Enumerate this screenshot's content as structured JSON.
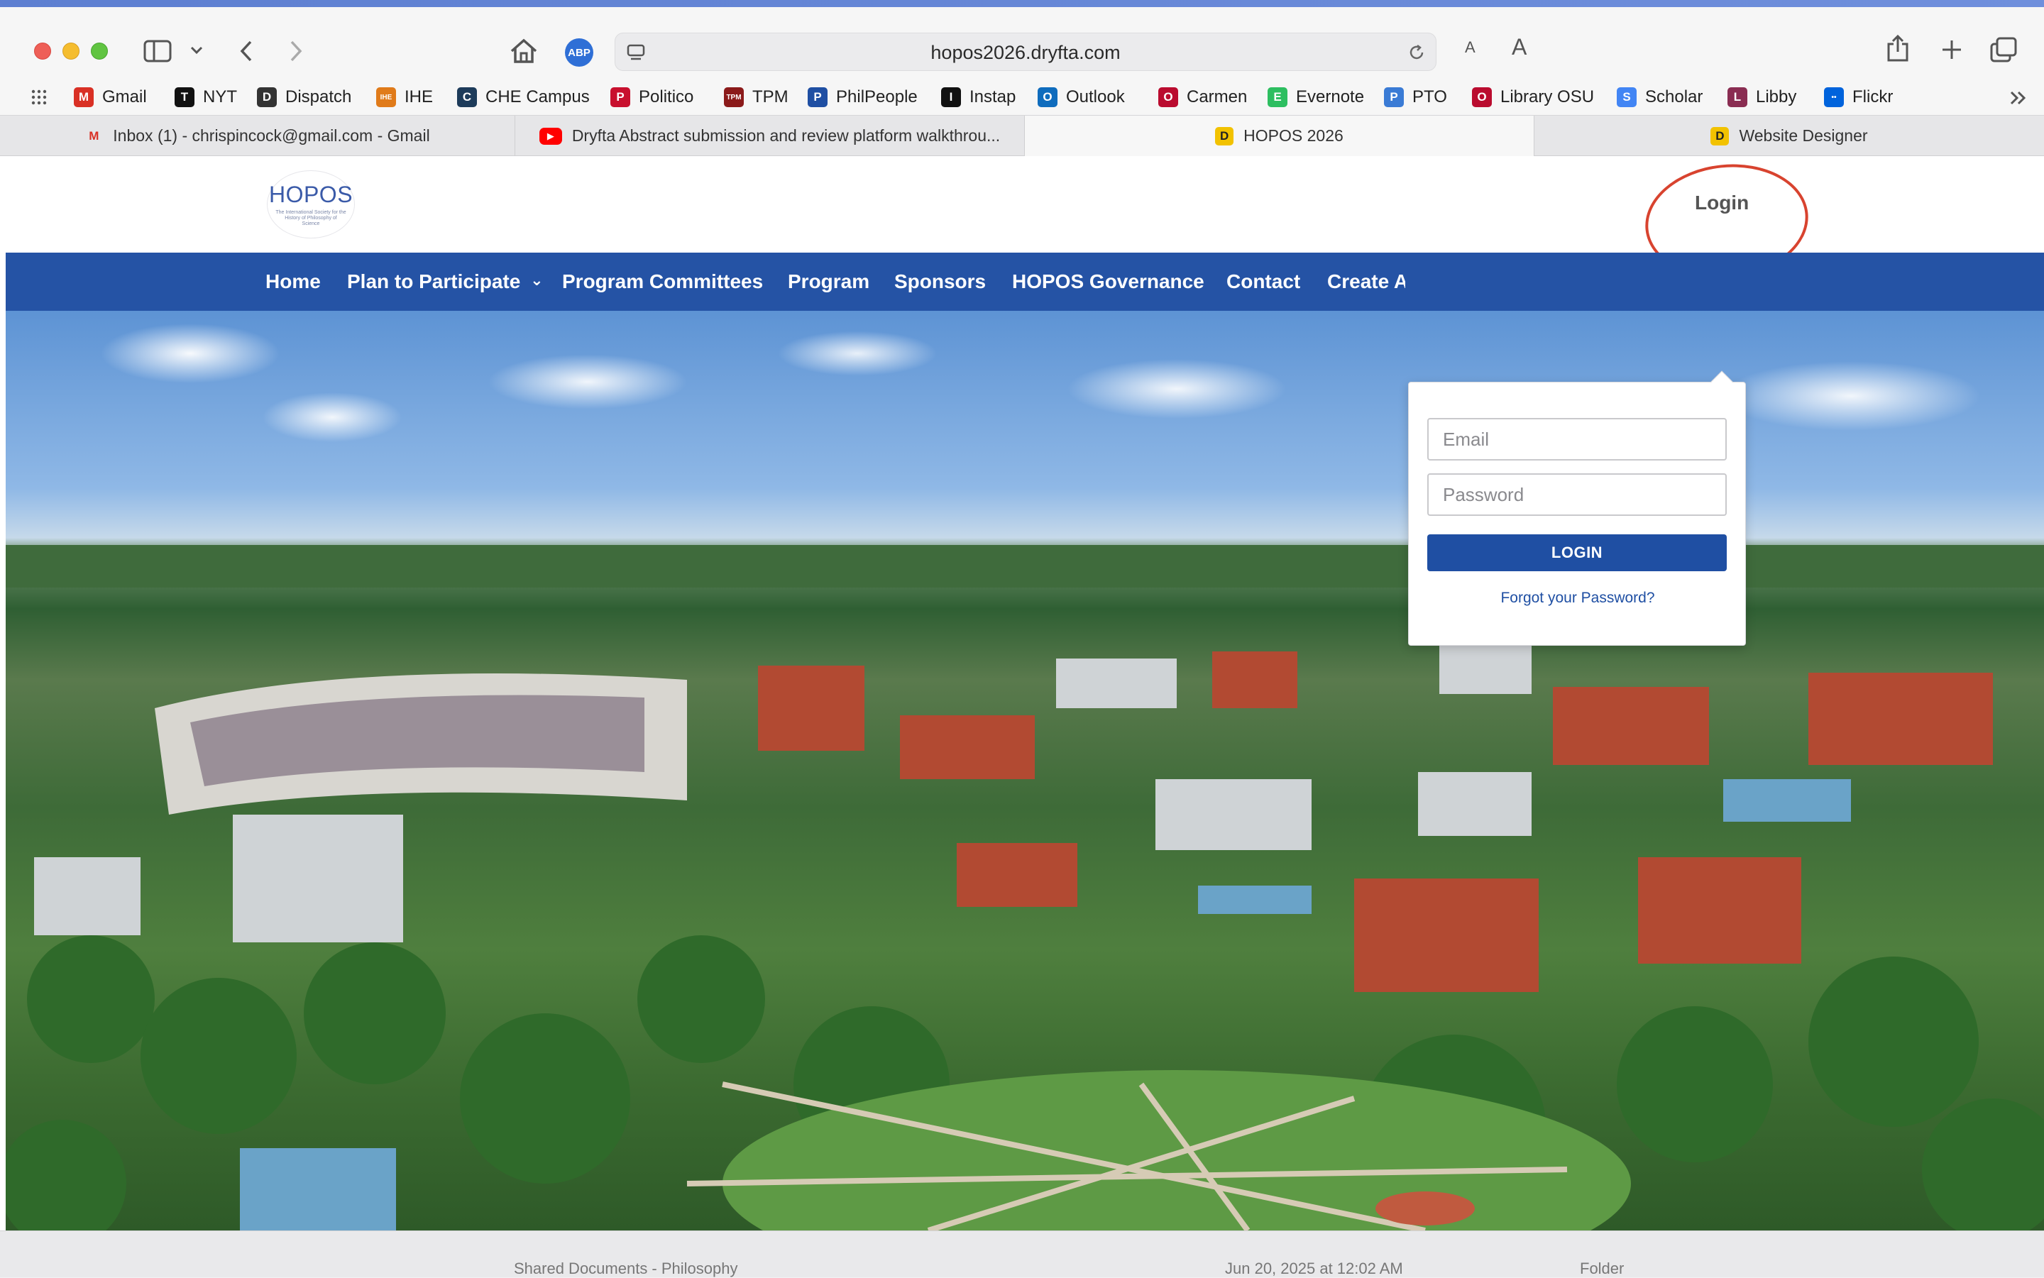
{
  "browser": {
    "url": "hopos2026.dryfta.com",
    "text_size_small": "A",
    "text_size_large": "A",
    "adblock_label": "ABP"
  },
  "bookmarks": [
    {
      "label": "Gmail",
      "icon": "gmail-icon",
      "color": "#d93025",
      "glyph": "M"
    },
    {
      "label": "NYT",
      "icon": "nyt-icon",
      "color": "#111111",
      "glyph": "T"
    },
    {
      "label": "Dispatch",
      "icon": "dispatch-icon",
      "color": "#333333",
      "glyph": "D"
    },
    {
      "label": "IHE",
      "icon": "ihe-icon",
      "color": "#e07b1a",
      "glyph": "IHE"
    },
    {
      "label": "CHE Campus",
      "icon": "che-icon",
      "color": "#1d3b5a",
      "glyph": "C"
    },
    {
      "label": "Politico",
      "icon": "politico-icon",
      "color": "#c8102e",
      "glyph": "P"
    },
    {
      "label": "TPM",
      "icon": "tpm-icon",
      "color": "#8b1a1a",
      "glyph": "TPM"
    },
    {
      "label": "PhilPeople",
      "icon": "philpeople-icon",
      "color": "#1f4fa3",
      "glyph": "P"
    },
    {
      "label": "Instap",
      "icon": "instapaper-icon",
      "color": "#111111",
      "glyph": "I"
    },
    {
      "label": "Outlook",
      "icon": "outlook-icon",
      "color": "#0f6cbd",
      "glyph": "O"
    },
    {
      "label": "Carmen",
      "icon": "carmen-icon",
      "color": "#ba0c2f",
      "glyph": "O"
    },
    {
      "label": "Evernote",
      "icon": "evernote-icon",
      "color": "#2dbe60",
      "glyph": "E"
    },
    {
      "label": "PTO",
      "icon": "pto-icon",
      "color": "#3a7bd5",
      "glyph": "P"
    },
    {
      "label": "Library OSU",
      "icon": "library-osu-icon",
      "color": "#ba0c2f",
      "glyph": "O"
    },
    {
      "label": "Scholar",
      "icon": "scholar-icon",
      "color": "#4285f4",
      "glyph": "S"
    },
    {
      "label": "Libby",
      "icon": "libby-icon",
      "color": "#8a2d52",
      "glyph": "L"
    },
    {
      "label": "Flickr",
      "icon": "flickr-icon",
      "color": "#0063dc",
      "glyph": "••"
    }
  ],
  "tabs": [
    {
      "label": "Inbox (1) - chrispincock@gmail.com - Gmail",
      "icon": "gmail-icon",
      "glyph": "M",
      "color": "#d93025",
      "active": false
    },
    {
      "label": "Dryfta Abstract submission and review platform walkthrou...",
      "icon": "youtube-icon",
      "glyph": "▶",
      "color": "#ff0000",
      "active": false
    },
    {
      "label": "HOPOS 2026",
      "icon": "dryfta-icon",
      "glyph": "D",
      "color": "#f2c200",
      "active": true
    },
    {
      "label": "Website Designer",
      "icon": "dryfta-icon",
      "glyph": "D",
      "color": "#f2c200",
      "active": false
    }
  ],
  "site": {
    "logo_text": "HOPOS",
    "logo_subtext": "The International Society for the History of Philosophy of Science",
    "login_label": "Login",
    "nav": [
      "Home",
      "Plan to Participate",
      "Program Committees",
      "Program",
      "Sponsors",
      "HOPOS Governance",
      "Contact",
      "Create A"
    ],
    "nav_dropdown_glyph": "⌄"
  },
  "login_popup": {
    "email_placeholder": "Email",
    "password_placeholder": "Password",
    "button_label": "LOGIN",
    "forgot_label": "Forgot your Password?"
  },
  "bottom_strip": {
    "ghost_left": "Shared Documents - Philosophy",
    "ghost_mid": "Jun 20, 2025 at 12:02 AM",
    "ghost_right": "Folder"
  },
  "colors": {
    "nav_bg": "#2553a5",
    "button_bg": "#1f4fa3",
    "annotation": "#d8432f"
  }
}
